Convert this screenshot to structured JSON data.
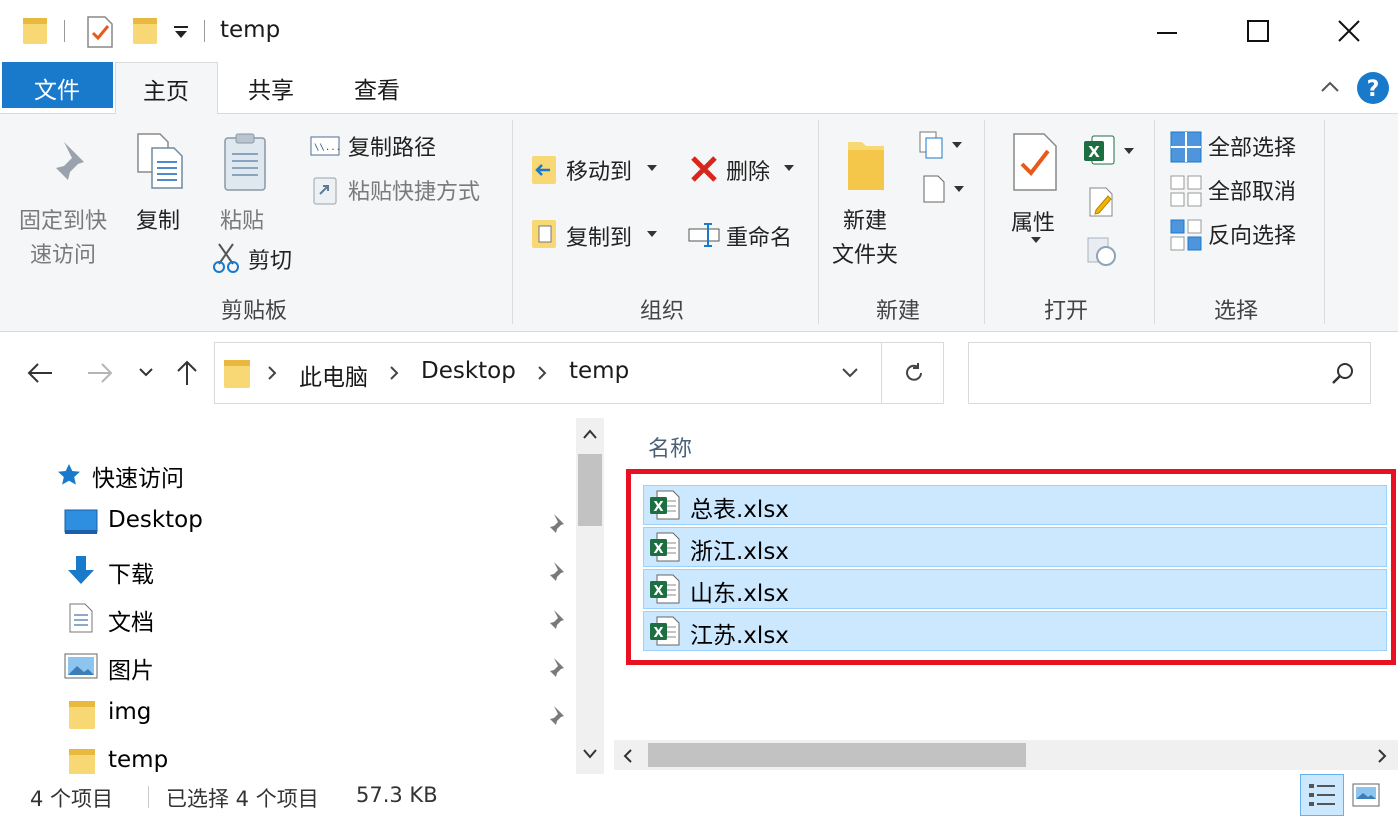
{
  "window": {
    "title": "temp",
    "minimize_icon": "minimize-icon",
    "maximize_icon": "maximize-icon",
    "close_icon": "close-icon"
  },
  "ribbon_tabs": [
    {
      "label": "文件",
      "active": false,
      "file_tab": true
    },
    {
      "label": "主页",
      "active": true
    },
    {
      "label": "共享",
      "active": false
    },
    {
      "label": "查看",
      "active": false
    }
  ],
  "ribbon": {
    "clipboard": {
      "pin_quick": "固定到快\n速访问",
      "pin_quick_l1": "固定到快",
      "pin_quick_l2": "速访问",
      "copy": "复制",
      "paste": "粘贴",
      "copy_path": "复制路径",
      "paste_shortcut": "粘贴快捷方式",
      "cut": "剪切",
      "group": "剪贴板"
    },
    "organize": {
      "move_to": "移动到",
      "copy_to": "复制到",
      "delete": "删除",
      "rename": "重命名",
      "group": "组织"
    },
    "new": {
      "new_folder_l1": "新建",
      "new_folder_l2": "文件夹",
      "group": "新建"
    },
    "open": {
      "properties": "属性",
      "group": "打开"
    },
    "select": {
      "select_all": "全部选择",
      "select_none": "全部取消",
      "invert": "反向选择",
      "group": "选择"
    }
  },
  "address": {
    "crumbs": [
      "此电脑",
      "Desktop",
      "temp"
    ],
    "search_placeholder": ""
  },
  "nav": {
    "quick_access": "快速访问",
    "items": [
      {
        "label": "Desktop",
        "icon": "desktop-icon"
      },
      {
        "label": "下载",
        "icon": "download-icon"
      },
      {
        "label": "文档",
        "icon": "document-icon"
      },
      {
        "label": "图片",
        "icon": "pictures-icon"
      },
      {
        "label": "img",
        "icon": "folder-icon"
      },
      {
        "label": "temp",
        "icon": "folder-icon"
      }
    ]
  },
  "file_list": {
    "column_name": "名称",
    "files": [
      "总表.xlsx",
      "浙江.xlsx",
      "山东.xlsx",
      "江苏.xlsx"
    ]
  },
  "status": {
    "count": "4 个项目",
    "selected": "已选择 4 个项目",
    "size": "57.3 KB"
  },
  "colors": {
    "accent": "#1979ca",
    "selection": "#cce8ff",
    "highlight_box": "#e81123",
    "excel_green": "#1d6f42"
  }
}
